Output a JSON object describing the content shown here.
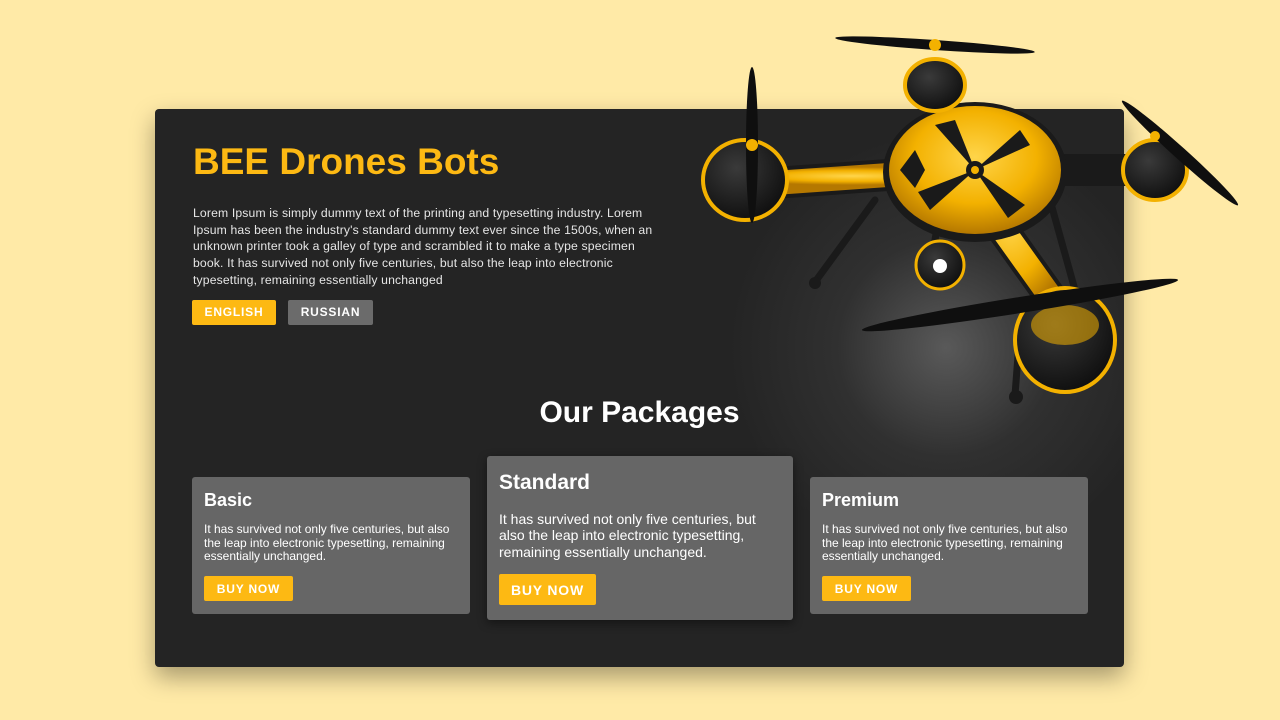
{
  "hero": {
    "title": "BEE Drones Bots",
    "description": "Lorem Ipsum is simply dummy text of the printing and typesetting industry. Lorem Ipsum has been the industry's standard dummy text ever since the 1500s, when an unknown printer took a galley of type and scrambled it to make a type specimen book. It has survived not only five centuries, but also the leap into electronic typesetting, remaining essentially unchanged",
    "buttons": {
      "english": "ENGLISH",
      "russian": "RUSSIAN"
    }
  },
  "packages": {
    "heading": "Our Packages",
    "items": [
      {
        "name": "Basic",
        "description": "It has survived not only five centuries, but also the leap into electronic typesetting, remaining essentially unchanged.",
        "button": "BUY NOW"
      },
      {
        "name": "Standard",
        "description": "It has survived not only five centuries, but also the leap into electronic typesetting, remaining essentially unchanged.",
        "button": "BUY NOW"
      },
      {
        "name": "Premium",
        "description": "It has survived not only five centuries, but also the leap into electronic typesetting, remaining essentially unchanged.",
        "button": "BUY NOW"
      }
    ]
  },
  "colors": {
    "page_background": "#ffeaa7",
    "card_background": "#242424",
    "accent": "#fdb913",
    "secondary_button": "#6b6b6b",
    "package_card": "#666666"
  },
  "icons": {
    "hero_image": "drone-image"
  }
}
